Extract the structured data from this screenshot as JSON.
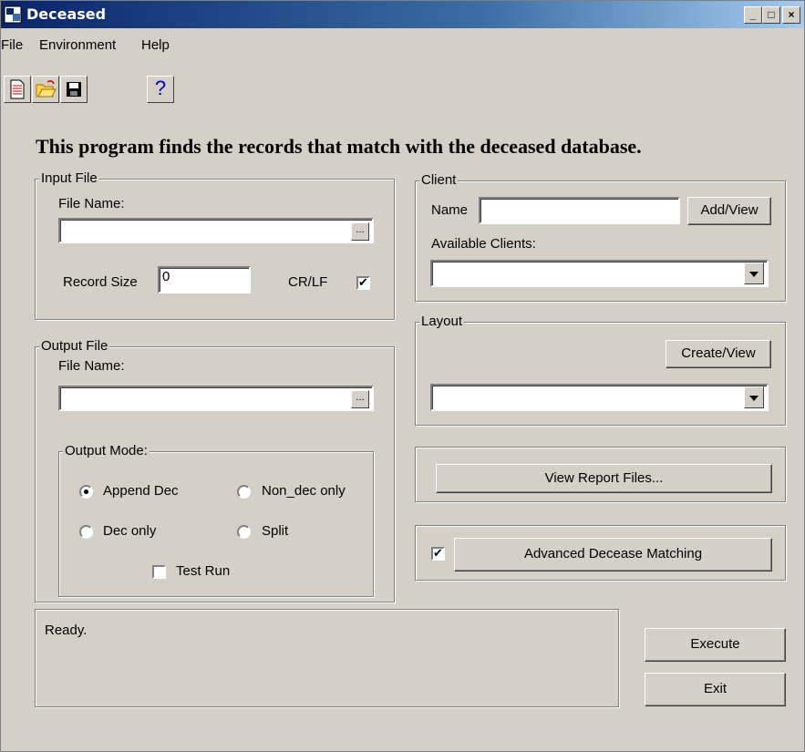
{
  "window": {
    "title": "Deceased",
    "controls": {
      "minimize": "_",
      "maximize": "□",
      "close": "×"
    }
  },
  "menu": [
    "File",
    "Environment",
    "Help"
  ],
  "toolbar": {
    "help_label": "?"
  },
  "heading": "This program finds the records that match with the deceased database.",
  "input_file": {
    "group_label": "Input File",
    "file_name_label": "File Name:",
    "file_name_value": "",
    "browse_label": "...",
    "record_size_label": "Record Size",
    "record_size_value": "0",
    "crlf_label": "CR/LF"
  },
  "output_file": {
    "group_label": "Output File",
    "file_name_label": "File Name:",
    "file_name_value": "",
    "browse_label": "...",
    "mode_group_label": "Output Mode:",
    "modes": [
      "Append Dec",
      "Non_dec only",
      "Dec only",
      "Split"
    ],
    "test_run_label": "Test Run"
  },
  "client": {
    "group_label": "Client",
    "name_label": "Name",
    "name_value": "",
    "add_view_label": "Add/View",
    "available_label": "Available Clients:"
  },
  "layout": {
    "group_label": "Layout",
    "create_view_label": "Create/View"
  },
  "view_report_label": "View Report Files...",
  "advanced_label": "Advanced Decease Matching",
  "status_text": "Ready.",
  "execute_label": "Execute",
  "exit_label": "Exit"
}
